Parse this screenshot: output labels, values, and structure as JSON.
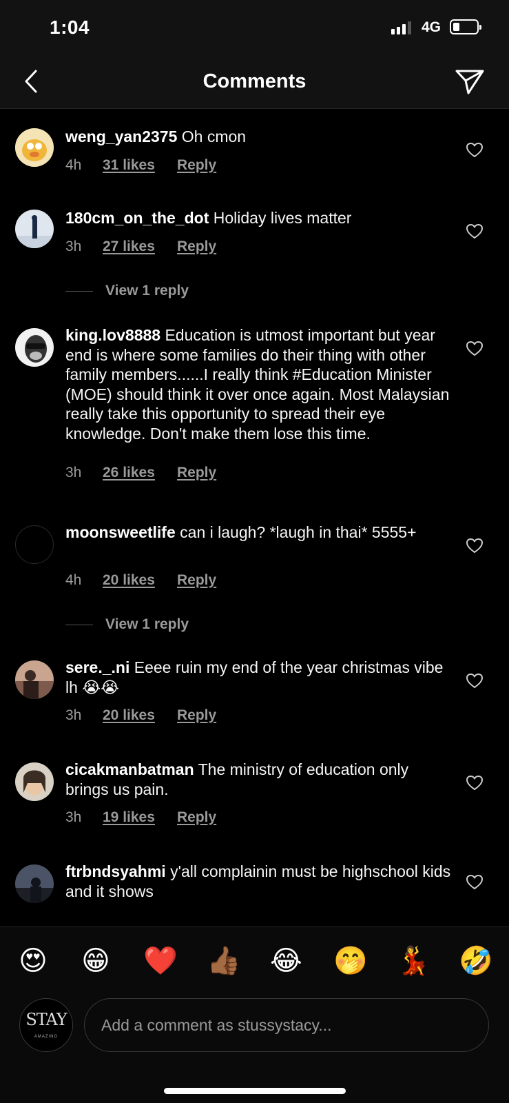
{
  "status": {
    "time": "1:04",
    "network": "4G"
  },
  "header": {
    "title": "Comments"
  },
  "comments": [
    {
      "username": "weng_yan2375",
      "text": "Oh cmon",
      "age": "4h",
      "likes": "31 likes",
      "reply": "Reply"
    },
    {
      "username": "180cm_on_the_dot",
      "text": "Holiday lives matter",
      "age": "3h",
      "likes": "27 likes",
      "reply": "Reply",
      "view_replies": "View 1 reply"
    },
    {
      "username": "king.lov8888",
      "text": "Education is utmost important but year end is where some families do their thing with other family members......I really think #Education Minister (MOE) should think it over once again. Most Malaysian really take this opportunity to spread their eye knowledge. Don't make them lose this time.",
      "age": "3h",
      "likes": "26 likes",
      "reply": "Reply"
    },
    {
      "username": "moonsweetlife",
      "text": "can i laugh? *laugh in thai* 5555+",
      "age": "4h",
      "likes": "20 likes",
      "reply": "Reply",
      "view_replies": "View 1 reply"
    },
    {
      "username": "sere._.ni",
      "text": "Eeee ruin my end of the year christmas vibe lh 😭😭",
      "age": "3h",
      "likes": "20 likes",
      "reply": "Reply"
    },
    {
      "username": "cicakmanbatman",
      "text": "The ministry of education only brings us pain.",
      "age": "3h",
      "likes": "19 likes",
      "reply": "Reply"
    },
    {
      "username": "ftrbndsyahmi",
      "text": "y'all complainin must be highschool kids and it shows"
    }
  ],
  "emoji_bar": [
    "😍",
    "😁",
    "❤️",
    "👍🏾",
    "😂",
    "🤭",
    "💃",
    "🤣"
  ],
  "compose": {
    "avatar_text": "STAY",
    "avatar_subtext": "AMAZING",
    "placeholder": "Add a comment as stussystacy..."
  },
  "icons": {
    "back": "chevron-left-icon",
    "send": "paper-plane-icon",
    "like": "heart-outline-icon"
  },
  "colors": {
    "background": "#000000",
    "secondary_text": "#9a9a9a"
  }
}
